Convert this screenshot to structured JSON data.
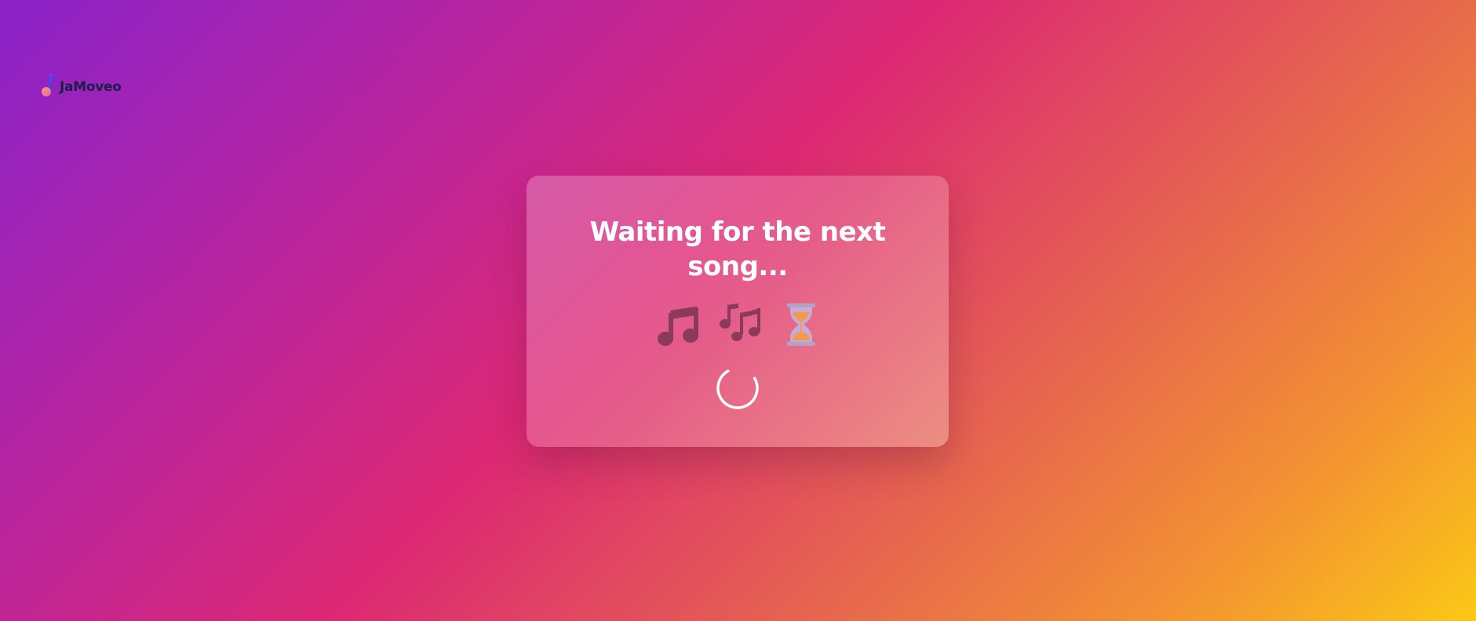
{
  "app": {
    "name": "JaMoveo",
    "logo_icon": "music-note-icon"
  },
  "waiting": {
    "title": "Waiting for the next song...",
    "icons": [
      "music-note-icon",
      "music-notes-icon",
      "hourglass-icon"
    ],
    "spinner": "loading-spinner"
  },
  "colors": {
    "gradient_start": "#8a22c9",
    "gradient_mid": "#dc2874",
    "gradient_end": "#fbc815",
    "title": "#ffffff",
    "logo_text": "#1c1f4a"
  }
}
